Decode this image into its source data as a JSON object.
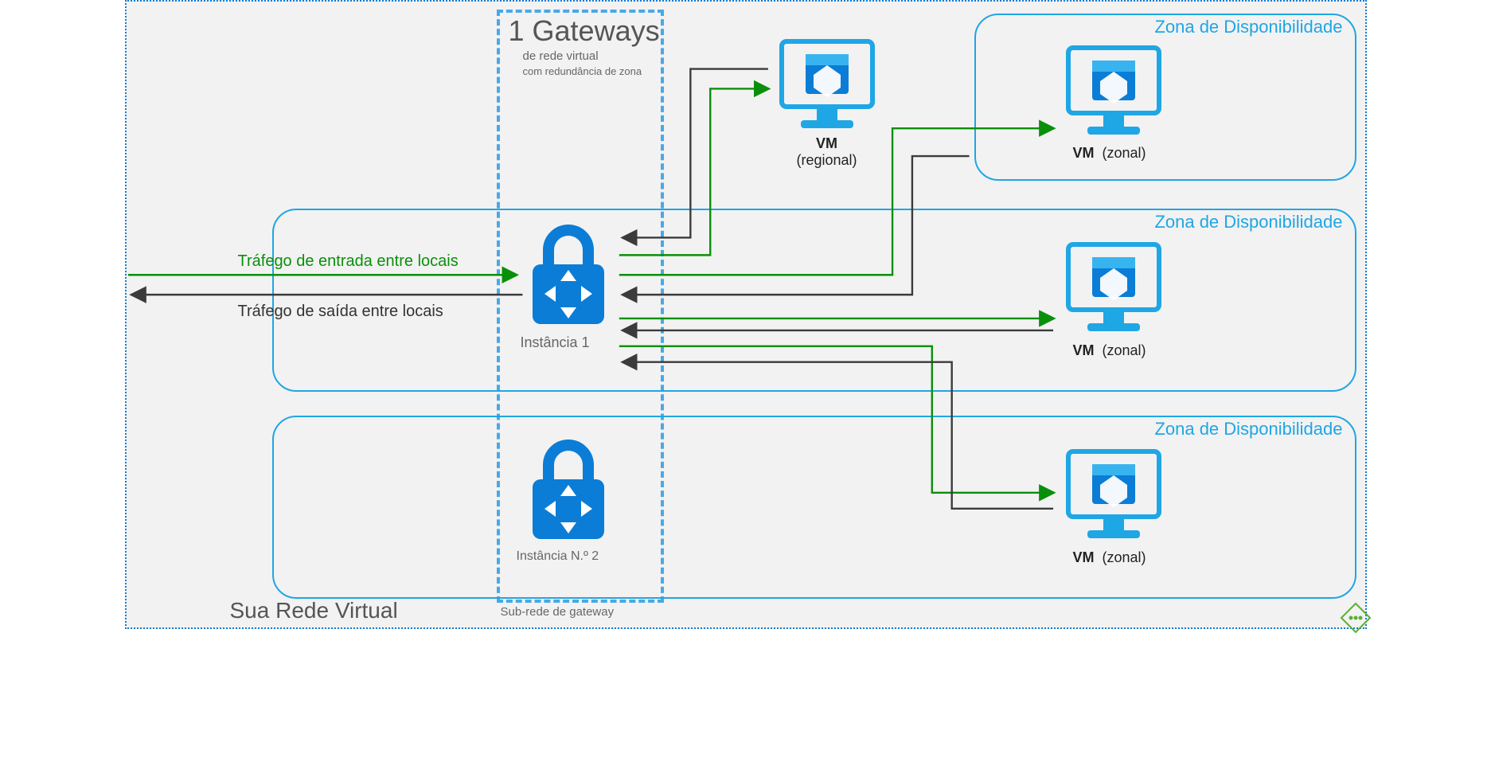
{
  "outer": {
    "vnet_label": "Sua Rede Virtual"
  },
  "gateway_box": {
    "title_line1": "1 Gateways",
    "title_line2": "de rede virtual",
    "title_line3": "com redundância de zona",
    "subnet_label": "Sub-rede de gateway"
  },
  "zones": {
    "z1": "Zona de Disponibilidade",
    "z2": "Zona de Disponibilidade",
    "z3": "Zona de Disponibilidade"
  },
  "gateways": {
    "inst1": "Instância 1",
    "inst2": "Instância N.º 2"
  },
  "vms": {
    "regional_name": "VM",
    "regional_sub": "(regional)",
    "zonal1_name": "VM",
    "zonal1_sub": "(zonal)",
    "zonal2_name": "VM",
    "zonal2_sub": "(zonal)",
    "zonal3_name": "VM",
    "zonal3_sub": "(zonal)"
  },
  "traffic": {
    "inbound": "Tráfego de entrada entre locais",
    "outbound": "Tráfego de saída entre locais"
  },
  "icons": {
    "gateway": "gateway-lock-icon",
    "vm": "vm-monitor-icon",
    "handle": "resize-handle-icon"
  },
  "colors": {
    "azure_blue": "#1fa6e5",
    "azure_dark": "#0b7dd6",
    "green": "#0a8f0a",
    "arrow_dark": "#3b3b3b"
  }
}
